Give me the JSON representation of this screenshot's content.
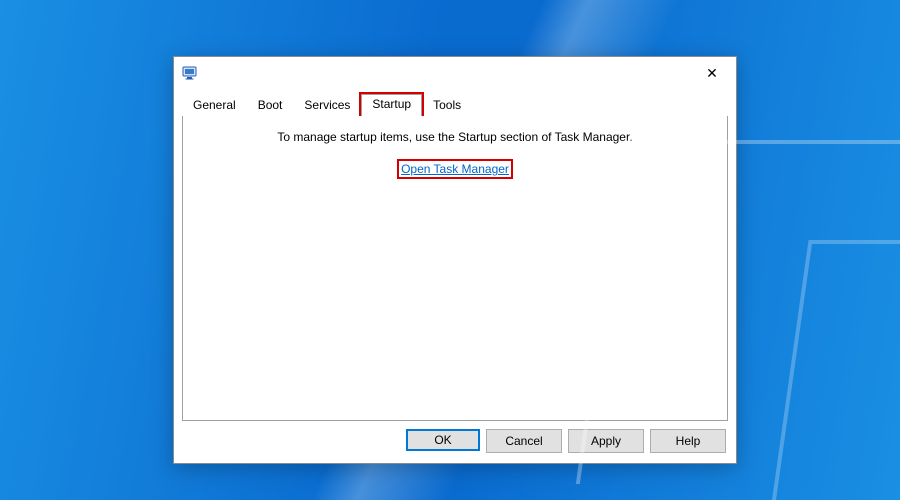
{
  "tabs": {
    "general": "General",
    "boot": "Boot",
    "services": "Services",
    "startup": "Startup",
    "tools": "Tools",
    "active": "startup"
  },
  "panel": {
    "instruction": "To manage startup items, use the Startup section of Task Manager.",
    "link_label": "Open Task Manager"
  },
  "buttons": {
    "ok": "OK",
    "cancel": "Cancel",
    "apply": "Apply",
    "help": "Help"
  }
}
